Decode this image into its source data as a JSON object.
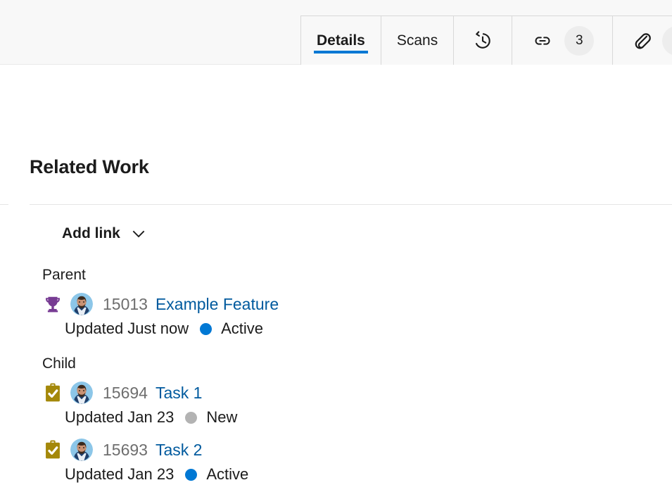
{
  "header": {
    "tabs": [
      {
        "id": "details",
        "label": "Details",
        "icon": null,
        "badge": null,
        "active": true
      },
      {
        "id": "scans",
        "label": "Scans",
        "icon": null,
        "badge": null,
        "active": false
      },
      {
        "id": "history",
        "label": "",
        "icon": "history-icon",
        "badge": null,
        "active": false
      },
      {
        "id": "links",
        "label": "",
        "icon": "link-icon",
        "badge": "3",
        "active": false
      },
      {
        "id": "attachments",
        "label": "",
        "icon": "attachment-icon",
        "badge": "",
        "active": false
      }
    ]
  },
  "main": {
    "section_title": "Related Work",
    "add_link": {
      "label": "Add link",
      "chevron": "chevron-down-icon"
    },
    "groups": [
      {
        "label": "Parent",
        "items": [
          {
            "type_icon": "feature-trophy-icon",
            "avatar": "user-avatar",
            "id": "15013",
            "title": "Example Feature",
            "updated": "Updated Just now",
            "state": "Active",
            "state_color": "#0078d4"
          }
        ]
      },
      {
        "label": "Child",
        "items": [
          {
            "type_icon": "task-clipboard-icon",
            "avatar": "user-avatar",
            "id": "15694",
            "title": "Task 1",
            "updated": "Updated Jan 23",
            "state": "New",
            "state_color": "#b3b3b3"
          },
          {
            "type_icon": "task-clipboard-icon",
            "avatar": "user-avatar",
            "id": "15693",
            "title": "Task 2",
            "updated": "Updated Jan 23",
            "state": "Active",
            "state_color": "#0078d4"
          }
        ]
      }
    ]
  },
  "colors": {
    "accent": "#0078d4",
    "link": "#005a9e",
    "id_text": "#6e6e6e",
    "feature_purple": "#773b93",
    "task_olive": "#a4880a",
    "state_new_gray": "#b3b3b3",
    "header_bg": "#f8f8f8"
  }
}
